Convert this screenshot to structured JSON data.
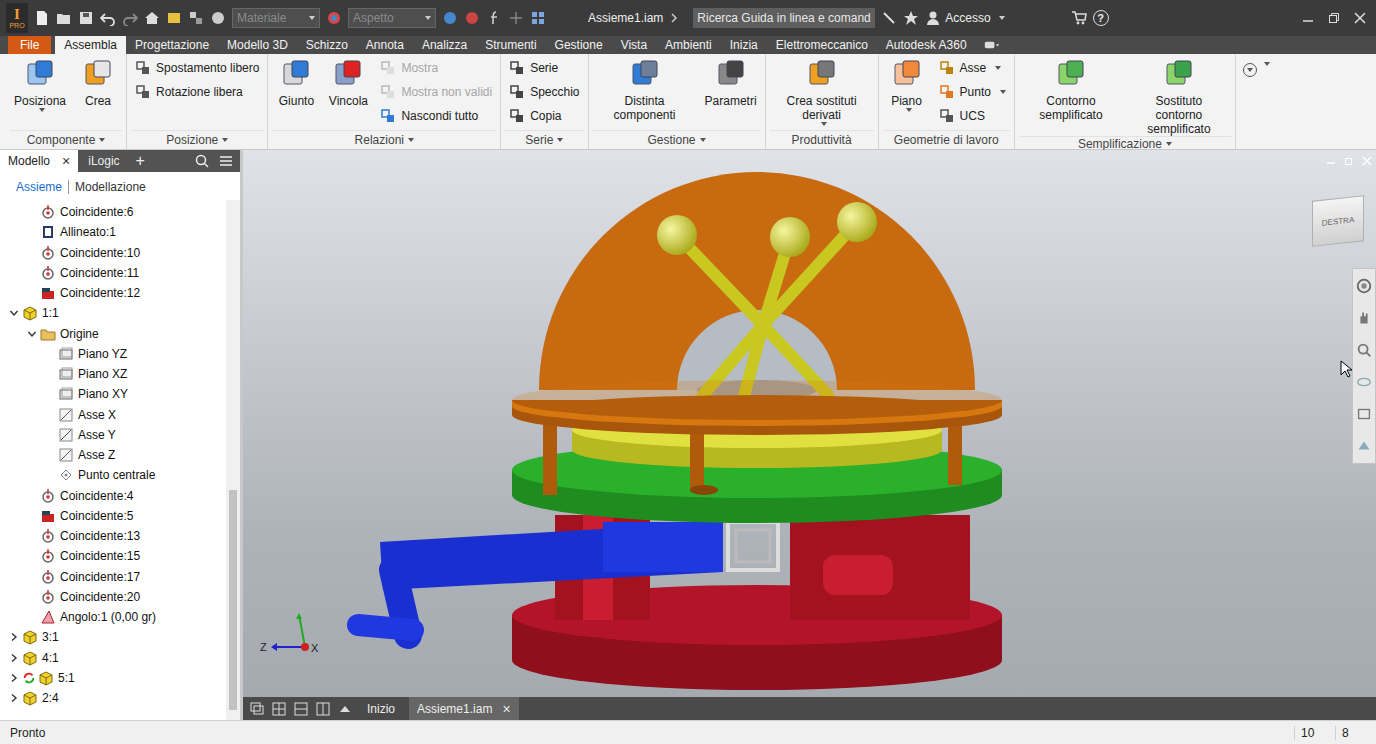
{
  "app": {
    "logo": {
      "letter": "I",
      "edition": "PRO"
    },
    "material": "Materiale",
    "appearance": "Aspetto",
    "title": "Assieme1.iam",
    "search_placeholder": "Ricerca Guida in linea e comand",
    "user": "Accesso",
    "help": "?"
  },
  "ribbon_tabs": [
    {
      "label": "File",
      "selected": false,
      "kind": "file"
    },
    {
      "label": "Assembla",
      "selected": true,
      "kind": "tab"
    },
    {
      "label": "Progettazione",
      "selected": false,
      "kind": "tab"
    },
    {
      "label": "Modello 3D",
      "selected": false,
      "kind": "tab"
    },
    {
      "label": "Schizzo",
      "selected": false,
      "kind": "tab"
    },
    {
      "label": "Annota",
      "selected": false,
      "kind": "tab"
    },
    {
      "label": "Analizza",
      "selected": false,
      "kind": "tab"
    },
    {
      "label": "Strumenti",
      "selected": false,
      "kind": "tab"
    },
    {
      "label": "Gestione",
      "selected": false,
      "kind": "tab"
    },
    {
      "label": "Vista",
      "selected": false,
      "kind": "tab"
    },
    {
      "label": "Ambienti",
      "selected": false,
      "kind": "tab"
    },
    {
      "label": "Inizia",
      "selected": false,
      "kind": "tab"
    },
    {
      "label": "Elettromeccanico",
      "selected": false,
      "kind": "tab"
    },
    {
      "label": "Autodesk A360",
      "selected": false,
      "kind": "tab"
    }
  ],
  "ribbon_groups": [
    {
      "title": "Componente",
      "menu": true,
      "items": [
        {
          "kind": "large",
          "label": "Posiziona",
          "menu": true,
          "disabled": false
        },
        {
          "kind": "large",
          "label": "Crea",
          "menu": false,
          "disabled": false
        }
      ]
    },
    {
      "title": "Posizione",
      "menu": true,
      "items": [
        {
          "kind": "stack",
          "buttons": [
            {
              "label": "Spostamento libero",
              "disabled": false,
              "menu": false
            },
            {
              "label": "Rotazione libera",
              "disabled": false,
              "menu": false
            }
          ]
        }
      ]
    },
    {
      "title": "Relazioni",
      "menu": true,
      "items": [
        {
          "kind": "large",
          "label": "Giunto",
          "menu": false,
          "disabled": false
        },
        {
          "kind": "large",
          "label": "Vincola",
          "menu": false,
          "disabled": false
        },
        {
          "kind": "stack",
          "buttons": [
            {
              "label": "Mostra",
              "disabled": true,
              "menu": false
            },
            {
              "label": "Mostra non validi",
              "disabled": true,
              "menu": false
            },
            {
              "label": "Nascondi tutto",
              "disabled": false,
              "menu": false
            }
          ]
        }
      ]
    },
    {
      "title": "Serie",
      "menu": true,
      "items": [
        {
          "kind": "stack",
          "buttons": [
            {
              "label": "Serie",
              "disabled": false,
              "menu": false
            },
            {
              "label": "Specchio",
              "disabled": false,
              "menu": false
            },
            {
              "label": "Copia",
              "disabled": false,
              "menu": false
            }
          ]
        }
      ]
    },
    {
      "title": "Gestione",
      "menu": true,
      "items": [
        {
          "kind": "large",
          "label": "Distinta componenti",
          "menu": false,
          "disabled": false
        },
        {
          "kind": "large",
          "label": "Parametri",
          "menu": false,
          "disabled": false
        }
      ]
    },
    {
      "title": "Produttività",
      "menu": false,
      "items": [
        {
          "kind": "large",
          "label": "Crea sostituti derivati",
          "menu": true,
          "disabled": false
        }
      ]
    },
    {
      "title": "Geometrie di lavoro",
      "menu": false,
      "items": [
        {
          "kind": "large",
          "label": "Piano",
          "menu": true,
          "disabled": false
        },
        {
          "kind": "stack",
          "buttons": [
            {
              "label": "Asse",
              "disabled": false,
              "menu": true
            },
            {
              "label": "Punto",
              "disabled": false,
              "menu": true
            },
            {
              "label": "UCS",
              "disabled": false,
              "menu": false
            }
          ]
        }
      ]
    },
    {
      "title": "Semplificazione",
      "menu": true,
      "items": [
        {
          "kind": "large",
          "label": "Contorno semplificato",
          "menu": false,
          "disabled": false
        },
        {
          "kind": "large",
          "label": "Sostituto contorno semplificato",
          "menu": false,
          "disabled": false
        }
      ]
    }
  ],
  "browser": {
    "tabs": [
      {
        "label": "Modello",
        "selected": true,
        "closable": true
      },
      {
        "label": "iLogic",
        "selected": false,
        "closable": false
      }
    ],
    "close": "×",
    "add": "+",
    "views": [
      {
        "label": "Assieme",
        "selected": true
      },
      {
        "label": "Modellazione",
        "selected": false
      }
    ],
    "tree": [
      {
        "label": "Coincidente:6",
        "depth": 1,
        "kind": "mate",
        "expandable": false,
        "expanded": false,
        "adaptive": false
      },
      {
        "label": "Allineato:1",
        "depth": 1,
        "kind": "aligned",
        "expandable": false,
        "expanded": false,
        "adaptive": false
      },
      {
        "label": "Coincidente:10",
        "depth": 1,
        "kind": "mate",
        "expandable": false,
        "expanded": false,
        "adaptive": false
      },
      {
        "label": "Coincidente:11",
        "depth": 1,
        "kind": "mate",
        "expandable": false,
        "expanded": false,
        "adaptive": false
      },
      {
        "label": "Coincidente:12",
        "depth": 1,
        "kind": "flush",
        "expandable": false,
        "expanded": false,
        "adaptive": false
      },
      {
        "label": "1:1",
        "depth": 0,
        "kind": "component",
        "expandable": true,
        "expanded": true,
        "adaptive": false
      },
      {
        "label": "Origine",
        "depth": 1,
        "kind": "folder",
        "expandable": true,
        "expanded": true,
        "adaptive": false
      },
      {
        "label": "Piano YZ",
        "depth": 2,
        "kind": "plane",
        "expandable": false,
        "expanded": false,
        "adaptive": false
      },
      {
        "label": "Piano XZ",
        "depth": 2,
        "kind": "plane",
        "expandable": false,
        "expanded": false,
        "adaptive": false
      },
      {
        "label": "Piano XY",
        "depth": 2,
        "kind": "plane",
        "expandable": false,
        "expanded": false,
        "adaptive": false
      },
      {
        "label": "Asse X",
        "depth": 2,
        "kind": "axis",
        "expandable": false,
        "expanded": false,
        "adaptive": false
      },
      {
        "label": "Asse Y",
        "depth": 2,
        "kind": "axis",
        "expandable": false,
        "expanded": false,
        "adaptive": false
      },
      {
        "label": "Asse Z",
        "depth": 2,
        "kind": "axis",
        "expandable": false,
        "expanded": false,
        "adaptive": false
      },
      {
        "label": "Punto centrale",
        "depth": 2,
        "kind": "point",
        "expandable": false,
        "expanded": false,
        "adaptive": false
      },
      {
        "label": "Coincidente:4",
        "depth": 1,
        "kind": "mate",
        "expandable": false,
        "expanded": false,
        "adaptive": false
      },
      {
        "label": "Coincidente:5",
        "depth": 1,
        "kind": "flush",
        "expandable": false,
        "expanded": false,
        "adaptive": false
      },
      {
        "label": "Coincidente:13",
        "depth": 1,
        "kind": "mate",
        "expandable": false,
        "expanded": false,
        "adaptive": false
      },
      {
        "label": "Coincidente:15",
        "depth": 1,
        "kind": "mate",
        "expandable": false,
        "expanded": false,
        "adaptive": false
      },
      {
        "label": "Coincidente:17",
        "depth": 1,
        "kind": "mate",
        "expandable": false,
        "expanded": false,
        "adaptive": false
      },
      {
        "label": "Coincidente:20",
        "depth": 1,
        "kind": "mate",
        "expandable": false,
        "expanded": false,
        "adaptive": false
      },
      {
        "label": "Angolo:1 (0,00 gr)",
        "depth": 1,
        "kind": "angle",
        "expandable": false,
        "expanded": false,
        "adaptive": false
      },
      {
        "label": "3:1",
        "depth": 0,
        "kind": "component",
        "expandable": true,
        "expanded": false,
        "adaptive": false
      },
      {
        "label": "4:1",
        "depth": 0,
        "kind": "component",
        "expandable": true,
        "expanded": false,
        "adaptive": false
      },
      {
        "label": "5:1",
        "depth": 0,
        "kind": "component",
        "expandable": true,
        "expanded": false,
        "adaptive": true
      },
      {
        "label": "2:4",
        "depth": 0,
        "kind": "component",
        "expandable": true,
        "expanded": false,
        "adaptive": false
      }
    ]
  },
  "viewport": {
    "viewcube": "DESTRA",
    "triad": {
      "z": "Z",
      "x": "X"
    }
  },
  "doc_tabs": [
    {
      "label": "Inizio",
      "selected": false,
      "closable": false
    },
    {
      "label": "Assieme1.iam",
      "selected": true,
      "closable": true
    }
  ],
  "status_bar": {
    "message": "Pronto",
    "values": [
      "10",
      "8"
    ]
  }
}
